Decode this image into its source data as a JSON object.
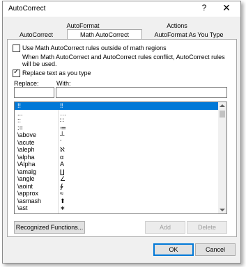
{
  "title": "AutoCorrect",
  "title_help_glyph": "?",
  "title_close_glyph": "✕",
  "tabs": {
    "row1": [
      "AutoFormat",
      "Actions"
    ],
    "row2": [
      "AutoCorrect",
      "Math AutoCorrect",
      "AutoFormat As You Type"
    ],
    "active": "Math AutoCorrect"
  },
  "options": {
    "outside_math": {
      "label": "Use Math AutoCorrect rules outside of math regions",
      "checked": false
    },
    "conflict_note": "When Math AutoCorrect and AutoCorrect rules conflict, AutoCorrect rules will be used.",
    "replace_as_you_type": {
      "label": "Replace text as you type",
      "checked": true
    }
  },
  "fields": {
    "replace_label": "Replace:",
    "with_label": "With:",
    "replace_value": "",
    "with_value": ""
  },
  "list": {
    "selected_index": 0,
    "rows": [
      {
        "replace": "!!",
        "with": "‼"
      },
      {
        "replace": "...",
        "with": "…"
      },
      {
        "replace": "::",
        "with": "∷"
      },
      {
        "replace": ":=",
        "with": "≔"
      },
      {
        "replace": "\\above",
        "with": "┴"
      },
      {
        "replace": "\\acute",
        "with": "´"
      },
      {
        "replace": "\\aleph",
        "with": "ℵ"
      },
      {
        "replace": "\\alpha",
        "with": "α"
      },
      {
        "replace": "\\Alpha",
        "with": "A"
      },
      {
        "replace": "\\amalg",
        "with": "∐"
      },
      {
        "replace": "\\angle",
        "with": "∠"
      },
      {
        "replace": "\\aoint",
        "with": "∳"
      },
      {
        "replace": "\\approx",
        "with": "≈"
      },
      {
        "replace": "\\asmash",
        "with": "⬆"
      },
      {
        "replace": "\\ast",
        "with": "∗"
      }
    ]
  },
  "buttons": {
    "recognized_functions": "Recognized Functions...",
    "add": "Add",
    "delete": "Delete",
    "ok": "OK",
    "cancel": "Cancel"
  }
}
